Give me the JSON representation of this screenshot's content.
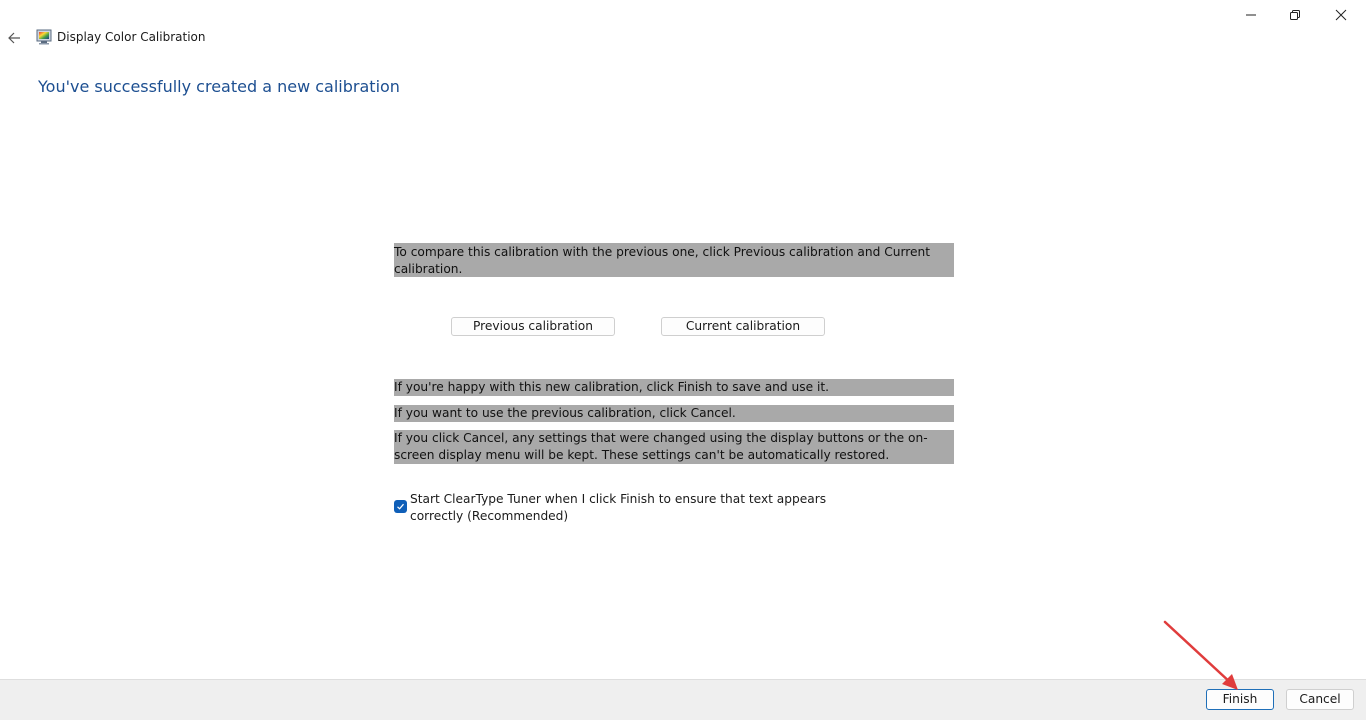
{
  "window": {
    "title": "Display Color Calibration",
    "app_icon": "monitor-color-icon",
    "controls": {
      "minimize": "minimize-icon",
      "maximize": "restore-icon",
      "close": "close-icon"
    },
    "back": "back-arrow-icon"
  },
  "page": {
    "heading": "You've successfully created a new calibration",
    "compare_text": "To compare this calibration with the previous one, click Previous calibration and Current calibration.",
    "buttons": {
      "previous": "Previous calibration",
      "current": "Current calibration"
    },
    "info": [
      "If you're happy with this new calibration, click Finish to save and use it.",
      "If you want to use the previous calibration, click Cancel.",
      "If you click Cancel, any settings that were changed using the display buttons or the on-screen display menu will be kept. These settings can't be automatically restored."
    ],
    "cleartype": {
      "checked": true,
      "label": "Start ClearType Tuner when I click Finish to ensure that text appears correctly (Recommended)"
    }
  },
  "footer": {
    "finish": "Finish",
    "cancel": "Cancel"
  },
  "colors": {
    "heading": "#1d4f91",
    "highlight": "#a9a9a9",
    "checkbox": "#0f5fb8",
    "annotation_arrow": "#e03c3c"
  }
}
